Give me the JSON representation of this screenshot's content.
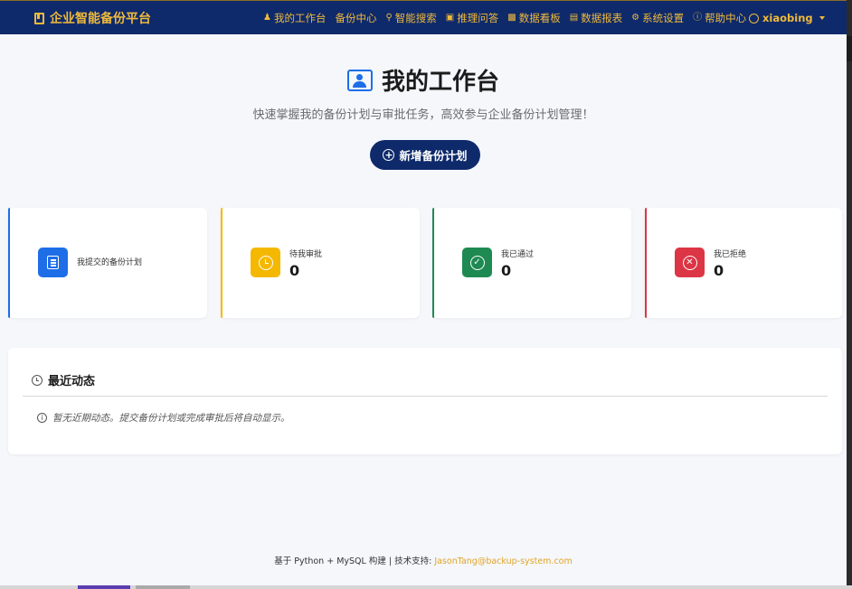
{
  "brand": {
    "title": "企业智能备份平台",
    "icon": "bookmark-icon",
    "color": "#f0b93a"
  },
  "nav": {
    "items": [
      {
        "label": "我的工作台",
        "icon": "user-icon"
      },
      {
        "label": "备份中心",
        "icon": ""
      },
      {
        "label": "智能搜索",
        "icon": "search-icon"
      },
      {
        "label": "推理问答",
        "icon": "robot-icon"
      },
      {
        "label": "数据看板",
        "icon": "bar-chart-icon"
      },
      {
        "label": "数据报表",
        "icon": "report-icon"
      },
      {
        "label": "系统设置",
        "icon": "gear-icon"
      },
      {
        "label": "帮助中心",
        "icon": "question-icon"
      }
    ],
    "user": "xiaobing"
  },
  "hero": {
    "title": "我的工作台",
    "subtitle": "快速掌握我的备份计划与审批任务，高效参与企业备份计划管理！",
    "add_button": "新增备份计划"
  },
  "stats": [
    {
      "label": "我提交的备份计划",
      "value": "",
      "color": "#1e6ee8",
      "icon": "list-icon"
    },
    {
      "label": "待我审批",
      "value": "0",
      "color": "#f5b800",
      "icon": "clock-icon"
    },
    {
      "label": "我已通过",
      "value": "0",
      "color": "#1e8a52",
      "icon": "check-circle-icon"
    },
    {
      "label": "我已拒绝",
      "value": "0",
      "color": "#dc3545",
      "icon": "x-circle-icon"
    }
  ],
  "recent": {
    "title": "最近动态",
    "empty_text": "暂无近期动态。提交备份计划或完成审批后将自动显示。"
  },
  "footer": {
    "text": "基于 Python + MySQL 构建 | 技术支持: ",
    "email": "JasonTang@backup-system.com"
  },
  "colors": {
    "navbar": "#0e2a6b",
    "accent": "#f0b93a",
    "background": "#f5f7fb"
  }
}
